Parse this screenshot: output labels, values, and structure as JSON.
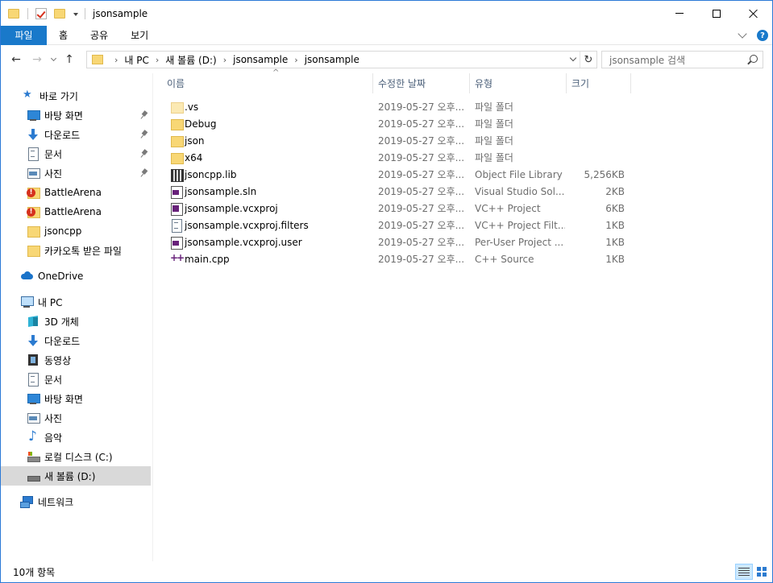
{
  "window": {
    "title": "jsonsample"
  },
  "ribbon": {
    "tabs": [
      "파일",
      "홈",
      "공유",
      "보기"
    ]
  },
  "address": {
    "crumbs": [
      "내 PC",
      "새 볼륨 (D:)",
      "jsonsample",
      "jsonsample"
    ],
    "search_placeholder": "jsonsample 검색"
  },
  "navpane": {
    "quick_access_label": "바로 가기",
    "quick_access": [
      {
        "label": "바탕 화면",
        "icon": "desktop-icon",
        "pinned": true
      },
      {
        "label": "다운로드",
        "icon": "download-icon",
        "pinned": true
      },
      {
        "label": "문서",
        "icon": "document-icon",
        "pinned": true
      },
      {
        "label": "사진",
        "icon": "picture-icon",
        "pinned": true
      },
      {
        "label": "BattleArena",
        "icon": "warning-folder-icon",
        "pinned": false
      },
      {
        "label": "BattleArena",
        "icon": "warning-folder-icon",
        "pinned": false
      },
      {
        "label": "jsoncpp",
        "icon": "folder-icon",
        "pinned": false
      },
      {
        "label": "카카오톡 받은 파일",
        "icon": "folder-icon",
        "pinned": false
      }
    ],
    "onedrive_label": "OneDrive",
    "pc_label": "내 PC",
    "pc_items": [
      {
        "label": "3D 개체",
        "icon": "3d-objects-icon"
      },
      {
        "label": "다운로드",
        "icon": "download-icon"
      },
      {
        "label": "동영상",
        "icon": "video-icon"
      },
      {
        "label": "문서",
        "icon": "document-icon"
      },
      {
        "label": "바탕 화면",
        "icon": "desktop-icon"
      },
      {
        "label": "사진",
        "icon": "picture-icon"
      },
      {
        "label": "음악",
        "icon": "music-icon"
      },
      {
        "label": "로컬 디스크 (C:)",
        "icon": "drive-c-icon"
      },
      {
        "label": "새 볼륨 (D:)",
        "icon": "drive-icon",
        "selected": true
      }
    ],
    "network_label": "네트워크"
  },
  "columns": {
    "name": "이름",
    "date": "수정한 날짜",
    "type": "유형",
    "size": "크기"
  },
  "files": [
    {
      "name": ".vs",
      "date": "2019-05-27 오후...",
      "type": "파일 폴더",
      "size": "",
      "icon": "folder-hidden-icon"
    },
    {
      "name": "Debug",
      "date": "2019-05-27 오후...",
      "type": "파일 폴더",
      "size": "",
      "icon": "folder-icon"
    },
    {
      "name": "json",
      "date": "2019-05-27 오후...",
      "type": "파일 폴더",
      "size": "",
      "icon": "folder-icon"
    },
    {
      "name": "x64",
      "date": "2019-05-27 오후...",
      "type": "파일 폴더",
      "size": "",
      "icon": "folder-icon"
    },
    {
      "name": "jsoncpp.lib",
      "date": "2019-05-27 오후...",
      "type": "Object File Library",
      "size": "5,256KB",
      "icon": "library-file-icon"
    },
    {
      "name": "jsonsample.sln",
      "date": "2019-05-27 오후...",
      "type": "Visual Studio Sol...",
      "size": "2KB",
      "icon": "solution-file-icon"
    },
    {
      "name": "jsonsample.vcxproj",
      "date": "2019-05-27 오후...",
      "type": "VC++ Project",
      "size": "6KB",
      "icon": "vcxproj-file-icon"
    },
    {
      "name": "jsonsample.vcxproj.filters",
      "date": "2019-05-27 오후...",
      "type": "VC++ Project Filt...",
      "size": "1KB",
      "icon": "filters-file-icon"
    },
    {
      "name": "jsonsample.vcxproj.user",
      "date": "2019-05-27 오후...",
      "type": "Per-User Project ...",
      "size": "1KB",
      "icon": "user-file-icon"
    },
    {
      "name": "main.cpp",
      "date": "2019-05-27 오후...",
      "type": "C++ Source",
      "size": "1KB",
      "icon": "cpp-file-icon"
    }
  ],
  "status": {
    "item_count": "10개 항목"
  }
}
